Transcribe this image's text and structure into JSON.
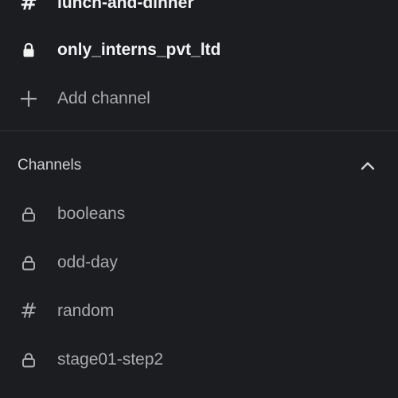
{
  "top_channels": [
    {
      "icon": "hash-icon",
      "label": "lunch-and-dinner",
      "bold": true
    },
    {
      "icon": "lock-icon",
      "label": "only_interns_pvt_ltd",
      "bold": true
    },
    {
      "icon": "plus-icon",
      "label": "Add channel",
      "bold": false
    }
  ],
  "channels_section": {
    "title": "Channels",
    "collapse_icon": "chevron-up-icon",
    "items": [
      {
        "icon": "lock-icon",
        "label": "booleans"
      },
      {
        "icon": "lock-icon",
        "label": "odd-day"
      },
      {
        "icon": "hash-icon",
        "label": "random"
      },
      {
        "icon": "lock-icon",
        "label": "stage01-step2"
      }
    ]
  },
  "colors": {
    "background": "#1b1d21",
    "bold_text": "#f2f2f2",
    "muted_text": "#a9aaab",
    "divider": "#34363a"
  }
}
